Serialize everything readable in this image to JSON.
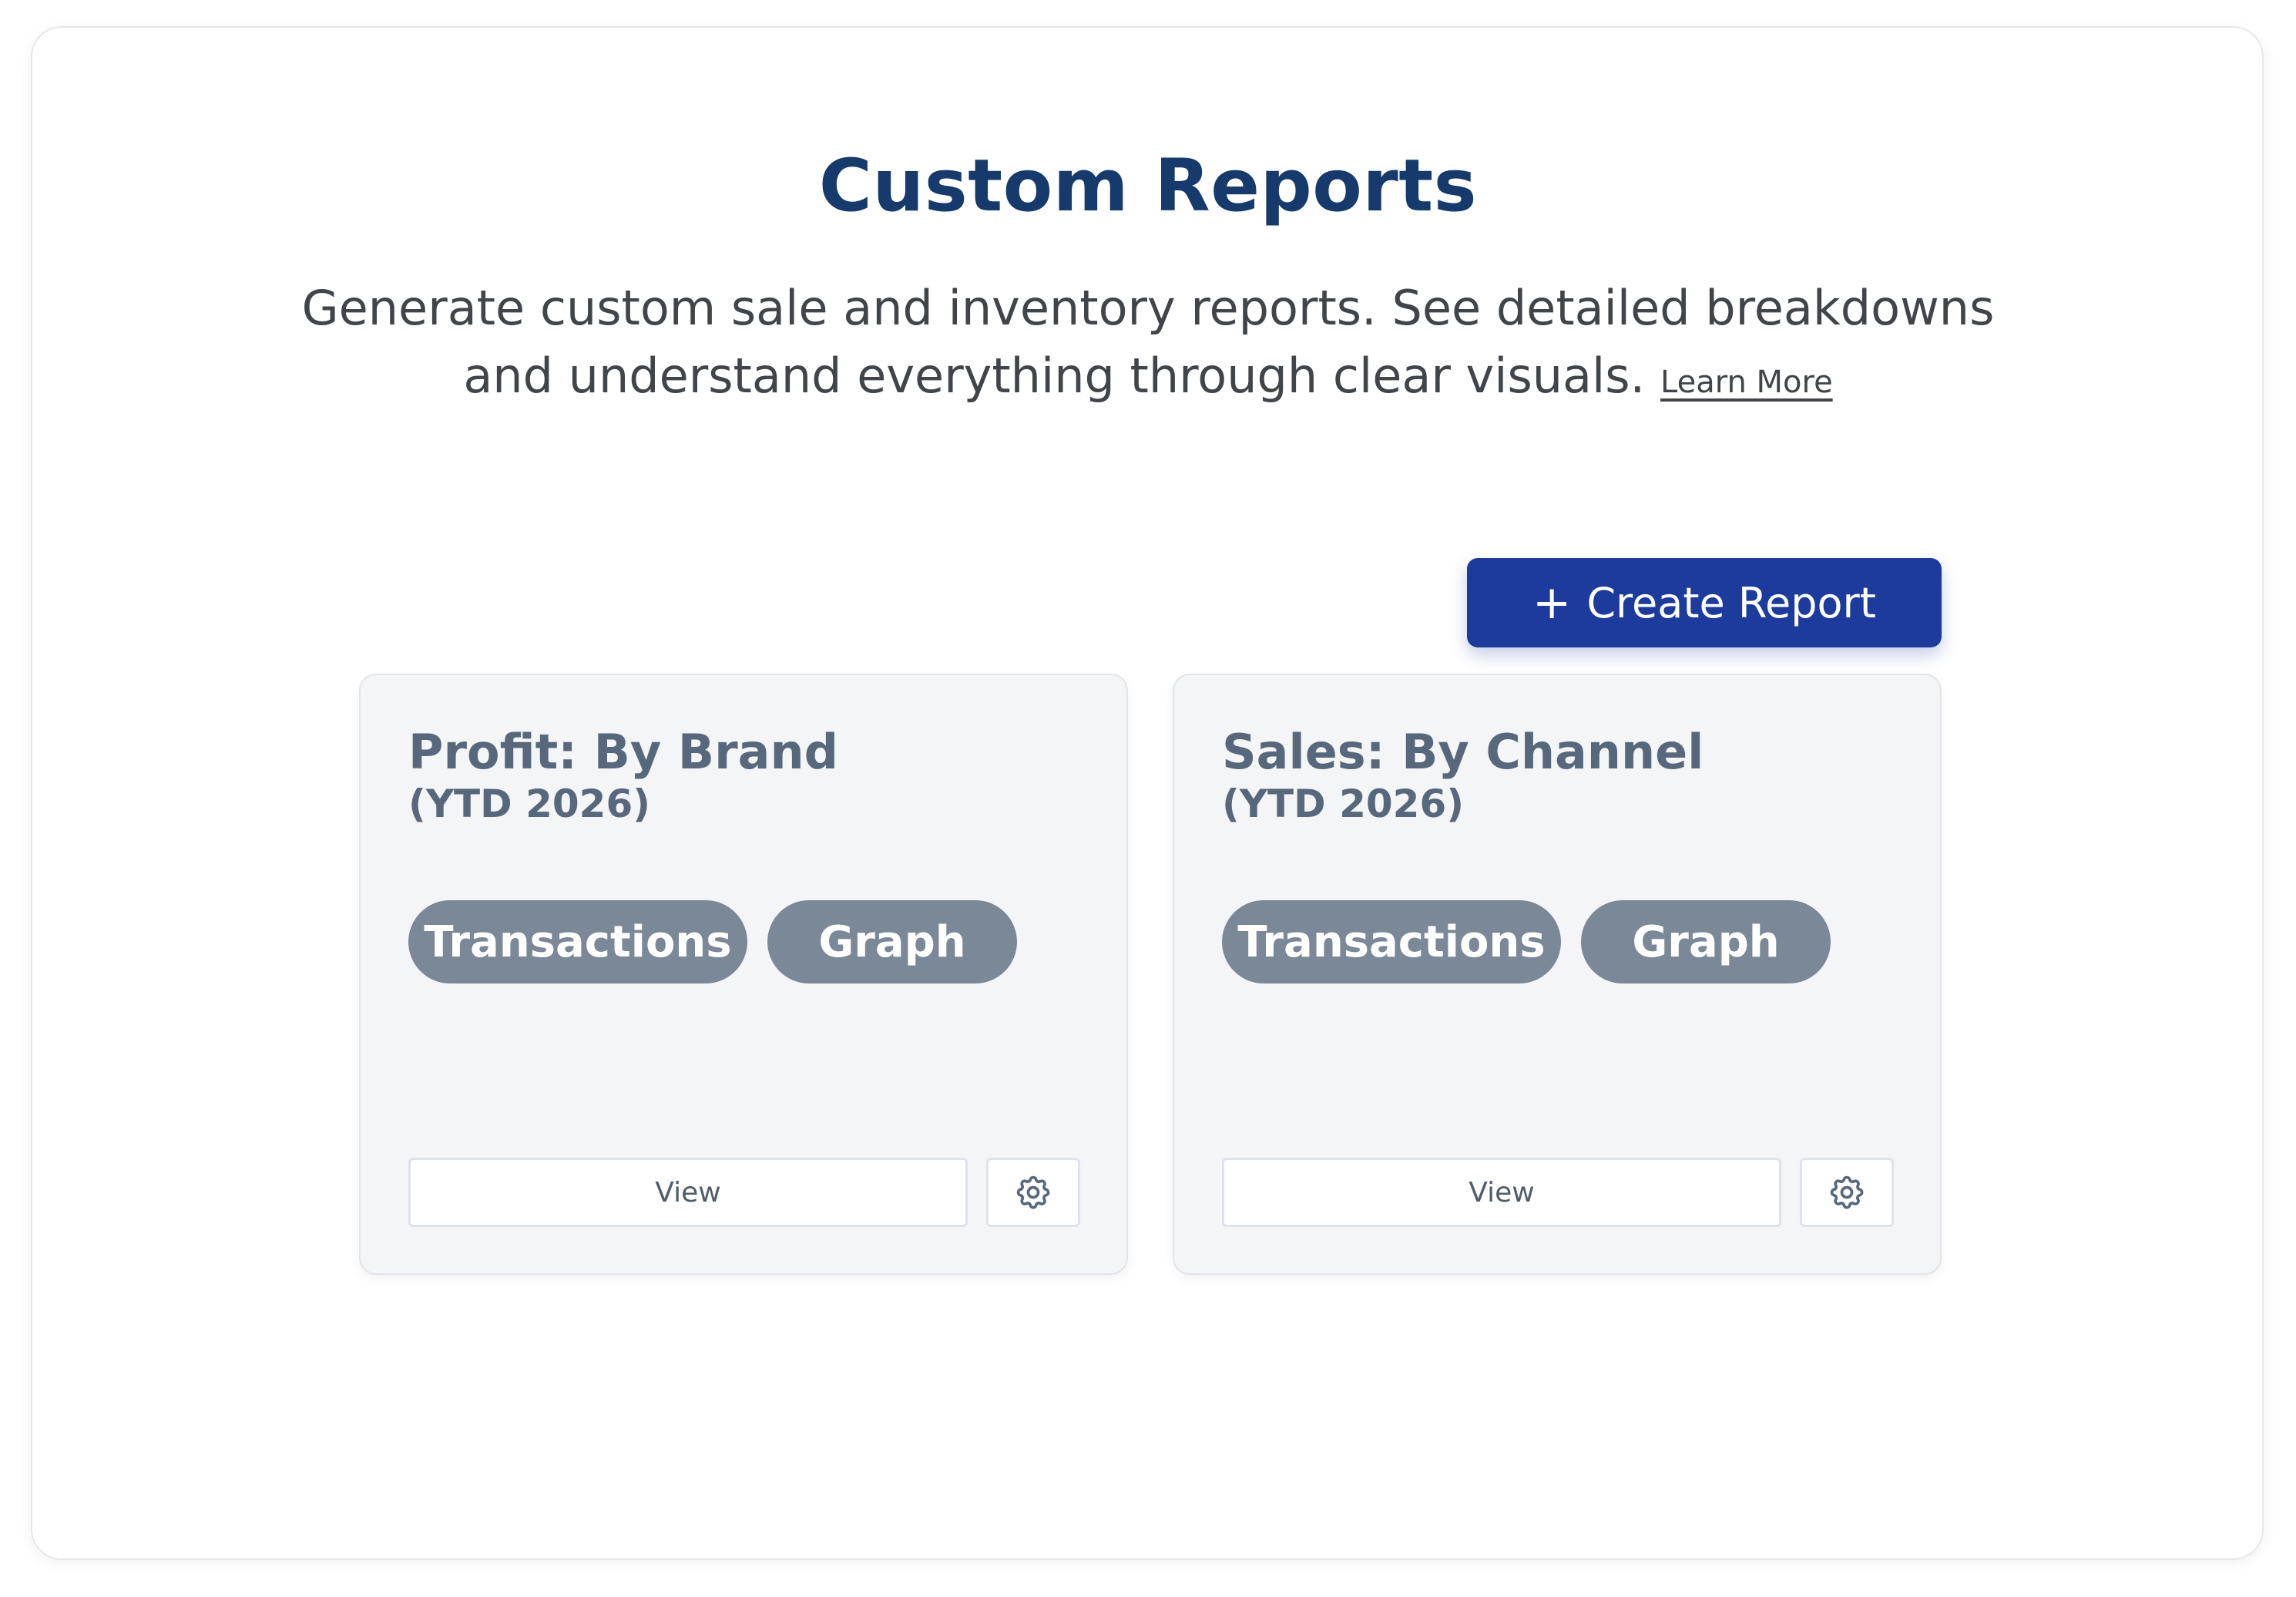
{
  "header": {
    "title": "Custom Reports",
    "subtitle": "Generate custom sale and inventory reports. See detailed breakdowns and understand everything through clear visuals.",
    "learn_more_label": "Learn More"
  },
  "toolbar": {
    "create_label": "Create Report",
    "create_icon": "plus-icon"
  },
  "colors": {
    "title": "#153a6b",
    "primary_button": "#1c3b9c",
    "chip": "#7a8897",
    "card_background": "#f4f5f7",
    "card_text": "#58687c"
  },
  "reports": [
    {
      "title": "Profit: By Brand",
      "period": "(YTD 2026)",
      "tags": [
        "Transactions",
        "Graph"
      ],
      "view_label": "View",
      "settings_icon": "gear-icon"
    },
    {
      "title": "Sales: By Channel",
      "period": "(YTD 2026)",
      "tags": [
        "Transactions",
        "Graph"
      ],
      "view_label": "View",
      "settings_icon": "gear-icon"
    }
  ]
}
